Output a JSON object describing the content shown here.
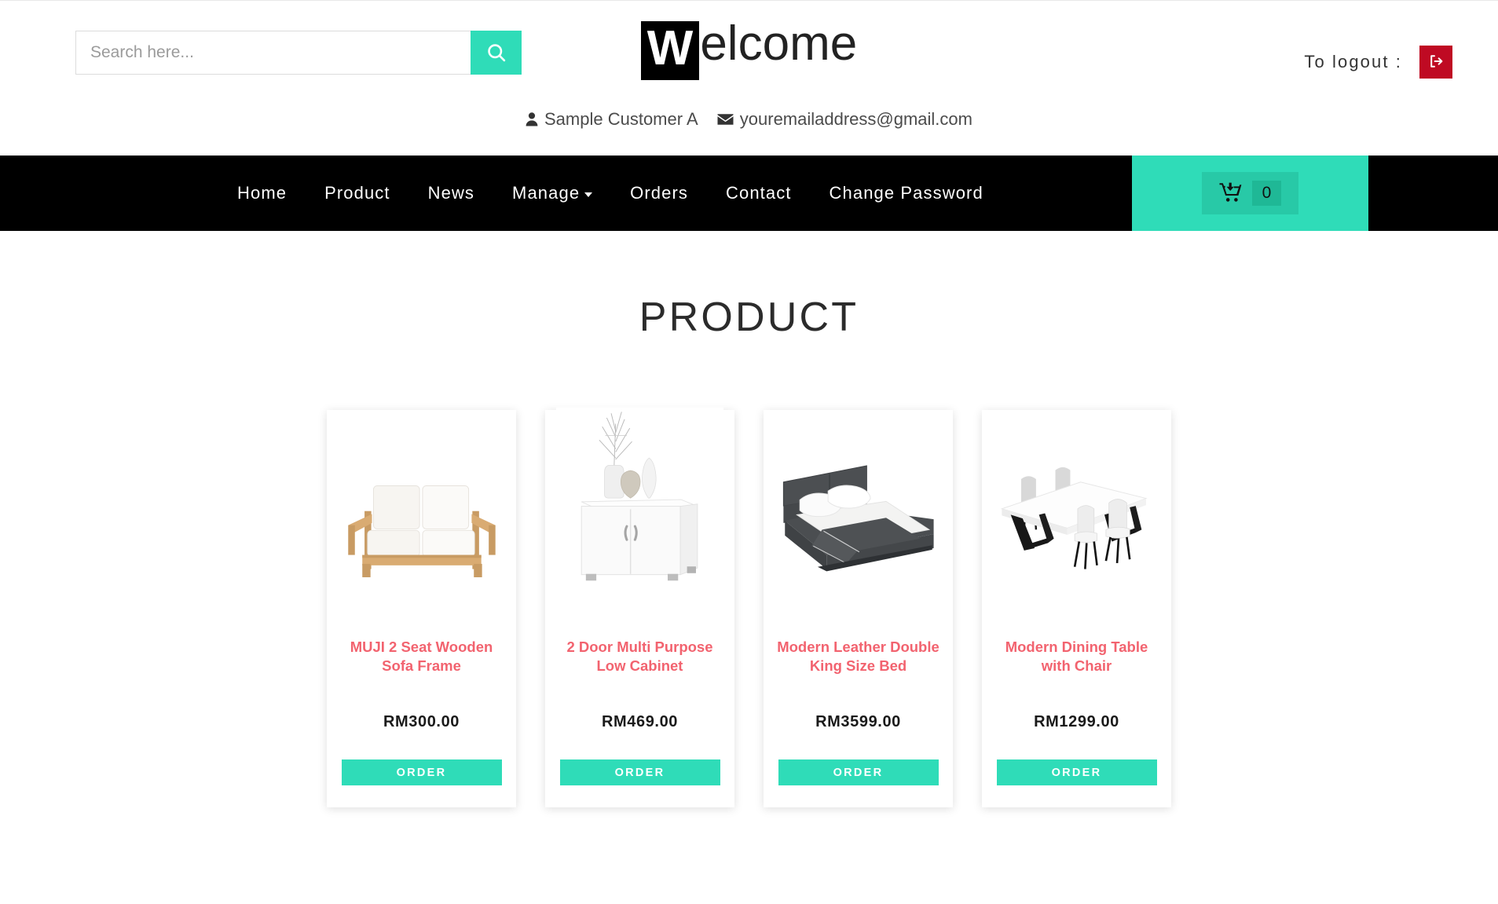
{
  "header": {
    "search": {
      "placeholder": "Search here...",
      "value": "",
      "icon": "search-icon"
    },
    "title_first_letter": "W",
    "title_rest": "elcome",
    "customer_name": "Sample Customer A",
    "customer_email": "youremailaddress@gmail.com",
    "customer_icon": "user-icon",
    "email_icon": "envelope-icon",
    "logout_label": "To logout :",
    "logout_icon": "sign-out-icon",
    "logout_color": "#bf0a23"
  },
  "nav": {
    "accent_color": "#2fdcb8",
    "background_color": "#000000",
    "items": [
      {
        "label": "Home",
        "has_caret": false
      },
      {
        "label": "Product",
        "has_caret": false
      },
      {
        "label": "News",
        "has_caret": false
      },
      {
        "label": "Manage",
        "has_caret": true
      },
      {
        "label": "Orders",
        "has_caret": false
      },
      {
        "label": "Contact",
        "has_caret": false
      },
      {
        "label": "Change Password",
        "has_caret": false
      }
    ],
    "cart": {
      "icon": "shopping-cart-arrow-down-icon",
      "count": "0"
    }
  },
  "main": {
    "page_title": "PRODUCT",
    "title_color": "#f2636f",
    "order_label": "ORDER",
    "products": [
      {
        "name": "MUJI 2 Seat Wooden Sofa Frame",
        "price": "RM300.00",
        "image": "wooden-sofa-image",
        "order_label": "ORDER"
      },
      {
        "name": "2 Door Multi Purpose Low Cabinet",
        "price": "RM469.00",
        "image": "white-cabinet-image",
        "order_label": "ORDER"
      },
      {
        "name": "Modern Leather Double King Size Bed",
        "price": "RM3599.00",
        "image": "leather-bed-image",
        "order_label": "ORDER"
      },
      {
        "name": "Modern Dining Table with Chair",
        "price": "RM1299.00",
        "image": "dining-table-image",
        "order_label": "ORDER"
      }
    ]
  }
}
